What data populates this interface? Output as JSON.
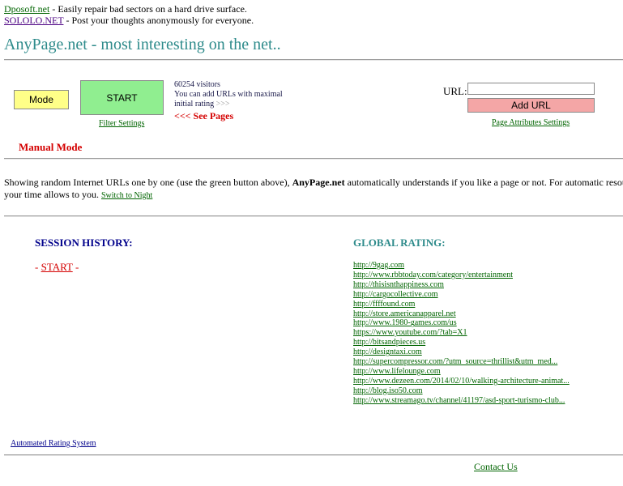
{
  "promos": [
    {
      "link": "Dposoft.net",
      "text": " - Easily repair bad sectors on a hard drive surface."
    },
    {
      "link": "SOLOLO.NET",
      "text": " - Post your thoughts anonymously for everyone."
    }
  ],
  "header": {
    "title": "AnyPage.net - most interesting on the net.."
  },
  "controls": {
    "mode_label": "Mode",
    "start_label": "START",
    "filter_settings": "Filter Settings",
    "visitors": "60254 visitors",
    "add_info": "You can add URLs with maximal initial rating",
    "add_info_arrows": ">>>",
    "see_pages": "<<< See Pages",
    "url_label": "URL:",
    "url_value": "",
    "add_url_label": "Add URL",
    "page_attr_settings": "Page Attributes Settings"
  },
  "mode_status": "Manual Mode",
  "description": {
    "part1": "Showing random Internet URLs one by one (use the green button above), ",
    "brand": "AnyPage.net",
    "part2": " automatically understands if you like a page or not. For automatic resour",
    "line2": "your time allows to you.",
    "switch_night": "Switch to Night"
  },
  "session_history": {
    "title": "SESSION HISTORY:",
    "prefix": "- ",
    "start_link": "START",
    "suffix": " -"
  },
  "global_rating": {
    "title": "GLOBAL RATING:",
    "urls": [
      "http://9gag.com",
      "http://www.rbbtoday.com/category/entertainment",
      "http://thisisnthappiness.com",
      "http://cargocollective.com",
      "http://ffffound.com",
      "http://store.americanapparel.net",
      "http://www.1980-games.com/us",
      "https://www.youtube.com/?tab=X1",
      "http://bitsandpieces.us",
      "http://designtaxi.com",
      "http://supercompressor.com/?utm_source=thrillist&utm_med...",
      "http://www.lifelounge.com",
      "http://www.dezeen.com/2014/02/10/walking-architecture-animat...",
      "http://blog.iso50.com",
      "http://www.streamago.tv/channel/41197/asd-sport-turismo-club..."
    ]
  },
  "footer": {
    "auto_rating": "Automated Rating System",
    "contact": "Contact Us"
  },
  "colors": {
    "mode_btn": "#ffff88",
    "start_btn": "#90ee90",
    "add_btn": "#f4a6a6",
    "title": "#2e8b8b",
    "alert": "#d40000",
    "link": "#006400"
  }
}
